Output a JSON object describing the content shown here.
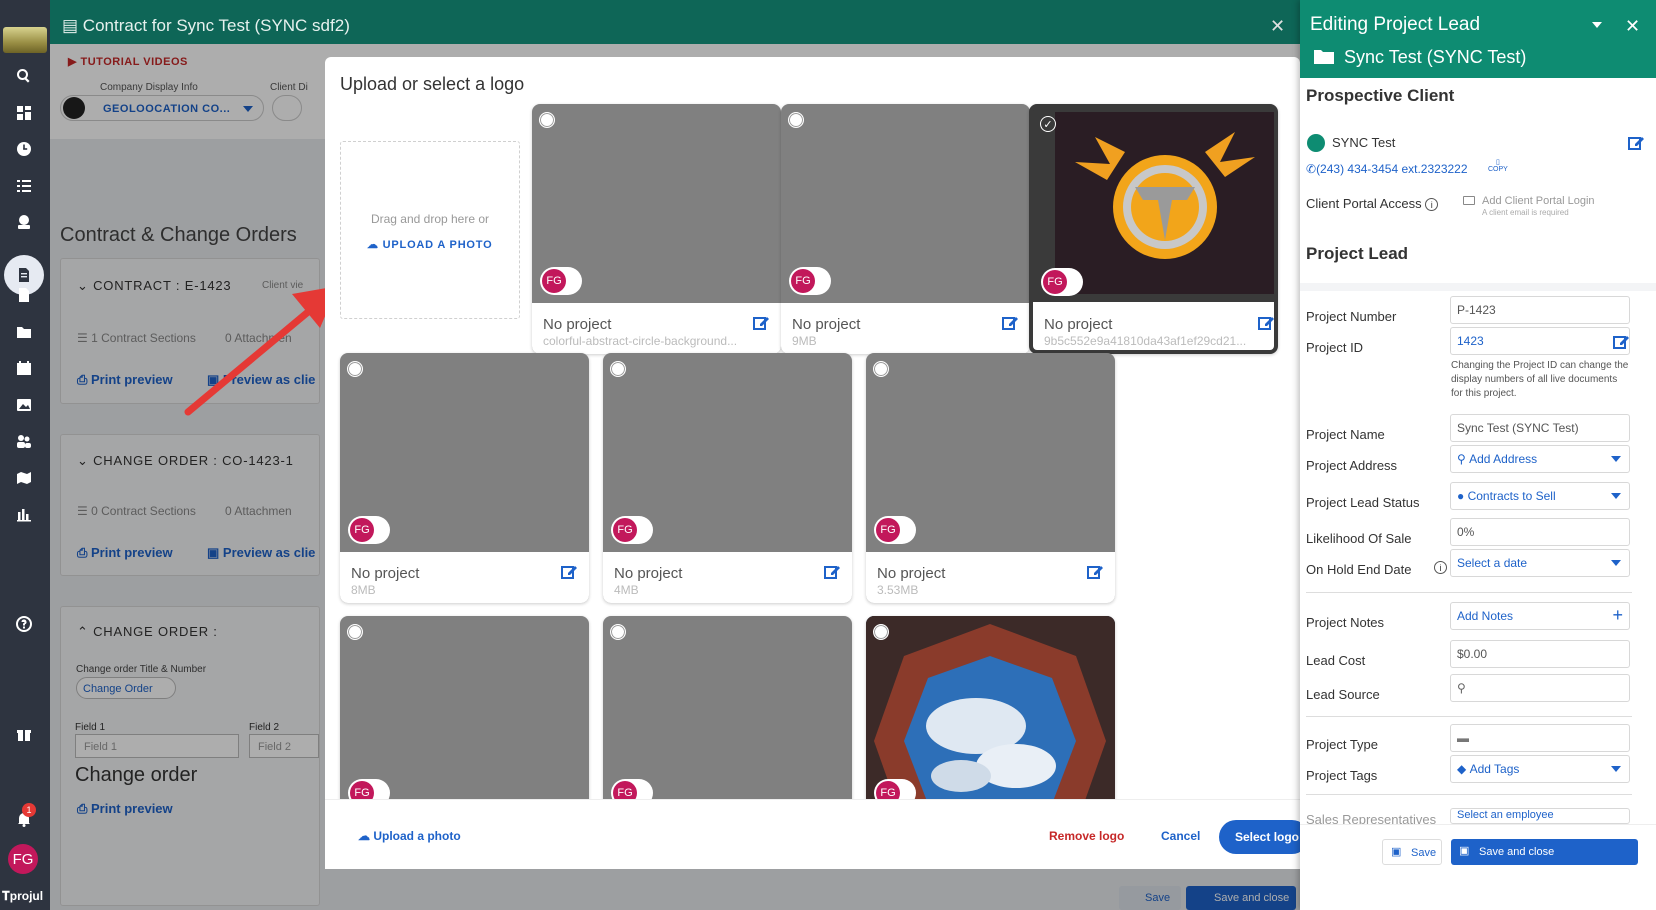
{
  "leftnav": {
    "items": [
      "search-icon",
      "dashboard-icon",
      "clock-icon",
      "list-icon",
      "estimate-icon",
      "contract-icon",
      "document-icon",
      "folder-icon",
      "calendar-icon",
      "photo-icon",
      "team-icon",
      "map-icon",
      "chart-icon",
      "help-icon",
      "gift-icon",
      "bell-icon"
    ],
    "notification_count": "1",
    "avatar_initials": "FG",
    "brand": "projul"
  },
  "contract": {
    "title": "Contract for Sync Test (SYNC sdf2)",
    "close": "✕",
    "tutorial": "TUTORIAL VIDEOS",
    "company_display_label": "Company Display Info",
    "client_display_label": "Client Di",
    "company_name": "GEOLOOCATION CO...",
    "section_title": "Contract & Change Orders",
    "contract_label": "CONTRACT : E-1423",
    "client_view": "Client vie",
    "contract_sections": "1",
    "contract_sections_label": "Contract Sections",
    "contract_attachments": "0",
    "attachments_label": "Attachmen",
    "print_preview": "Print preview",
    "preview_as_client": "Preview as clie",
    "change_order_1_label": "CHANGE ORDER : CO-1423-1",
    "change_order_1_sections": "0",
    "change_order_1_attachments": "0",
    "change_order_2_label": "CHANGE ORDER :",
    "change_order_title_number": "Change order Title & Number",
    "change_order_btn": "Change Order",
    "field1_label": "Field 1",
    "field1_placeholder": "Field 1",
    "field2_label": "Field 2",
    "field2_placeholder": "Field 2",
    "change_order_heading": "Change order",
    "save": "Save",
    "save_and_close": "Save and close"
  },
  "modal": {
    "title": "Upload or select a logo",
    "dropzone_text": "Drag and drop here or",
    "dropzone_upload": "UPLOAD A PHOTO",
    "tiles": [
      {
        "title": "No project",
        "sub": "colorful-abstract-circle-background...",
        "initials": "FG",
        "selected": false
      },
      {
        "title": "No project",
        "sub": "9MB",
        "initials": "FG",
        "selected": false
      },
      {
        "title": "No project",
        "sub": "9b5c552e9a41810da43af1ef29cd21...",
        "initials": "FG",
        "selected": true
      },
      {
        "title": "No project",
        "sub": "8MB",
        "initials": "FG",
        "selected": false
      },
      {
        "title": "No project",
        "sub": "4MB",
        "initials": "FG",
        "selected": false
      },
      {
        "title": "No project",
        "sub": "3.53MB",
        "initials": "FG",
        "selected": false
      },
      {
        "title": "",
        "sub": "",
        "initials": "FG",
        "selected": false
      },
      {
        "title": "",
        "sub": "",
        "initials": "FG",
        "selected": false
      },
      {
        "title": "",
        "sub": "",
        "initials": "FG",
        "selected": false
      }
    ],
    "footer": {
      "upload": "Upload a photo",
      "remove": "Remove logo",
      "cancel": "Cancel",
      "select": "Select logo"
    }
  },
  "panel": {
    "title": "Editing Project Lead",
    "project": "Sync Test (SYNC Test)",
    "prospective_client": "Prospective Client",
    "client_name": "SYNC Test",
    "phone": "(243) 434-3454 ext.2323222",
    "copy": "COPY",
    "portal_access_label": "Client Portal Access",
    "portal_login": "Add Client Portal Login",
    "portal_hint": "A client email is required",
    "project_lead_heading": "Project Lead",
    "fields": {
      "project_number_label": "Project Number",
      "project_number": "P-1423",
      "project_id_label": "Project ID",
      "project_id": "1423",
      "project_id_hint": "Changing the Project ID can change the display numbers of all live documents for this project.",
      "project_name_label": "Project Name",
      "project_name": "Sync Test (SYNC Test)",
      "project_address_label": "Project Address",
      "project_address": "Add Address",
      "lead_status_label": "Project Lead Status",
      "lead_status": "Contracts to Sell",
      "likelihood_label": "Likelihood Of Sale",
      "likelihood": "0%",
      "on_hold_label": "On Hold End Date",
      "on_hold": "Select a date",
      "notes_label": "Project Notes",
      "notes": "Add Notes",
      "lead_cost_label": "Lead Cost",
      "lead_cost": "$0.00",
      "lead_source_label": "Lead Source",
      "project_type_label": "Project Type",
      "project_tags_label": "Project Tags",
      "project_tags": "Add Tags",
      "sales_reps_label": "Sales Representatives",
      "sales_reps": "Select an employee"
    },
    "save": "Save",
    "save_and_close": "Save and close"
  },
  "colors": {
    "brand_green": "#0e8c72",
    "header_green": "#0e6657",
    "link_blue": "#1e62c9",
    "avatar": "#c2185b",
    "danger": "#c62828",
    "arrow": "#e53935"
  }
}
